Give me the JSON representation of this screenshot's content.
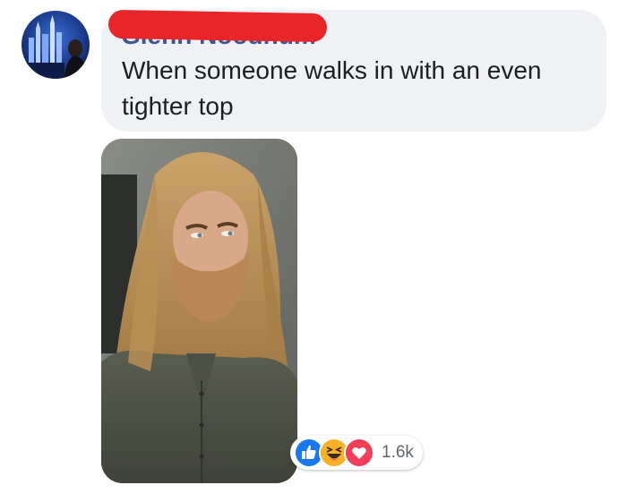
{
  "comment": {
    "author_name": "Glenn Noodnum",
    "text": "When someone walks in with an even tighter top"
  },
  "reactions": {
    "types": [
      "like-icon",
      "haha-icon",
      "love-icon"
    ],
    "count": "1.6k",
    "colors": {
      "like": "#1877f2",
      "haha": "#f7b125",
      "love": "#f33e58"
    }
  },
  "colors": {
    "bubble": "#f0f1f4",
    "redaction": "#e8262a",
    "text": "#1c1e21"
  }
}
